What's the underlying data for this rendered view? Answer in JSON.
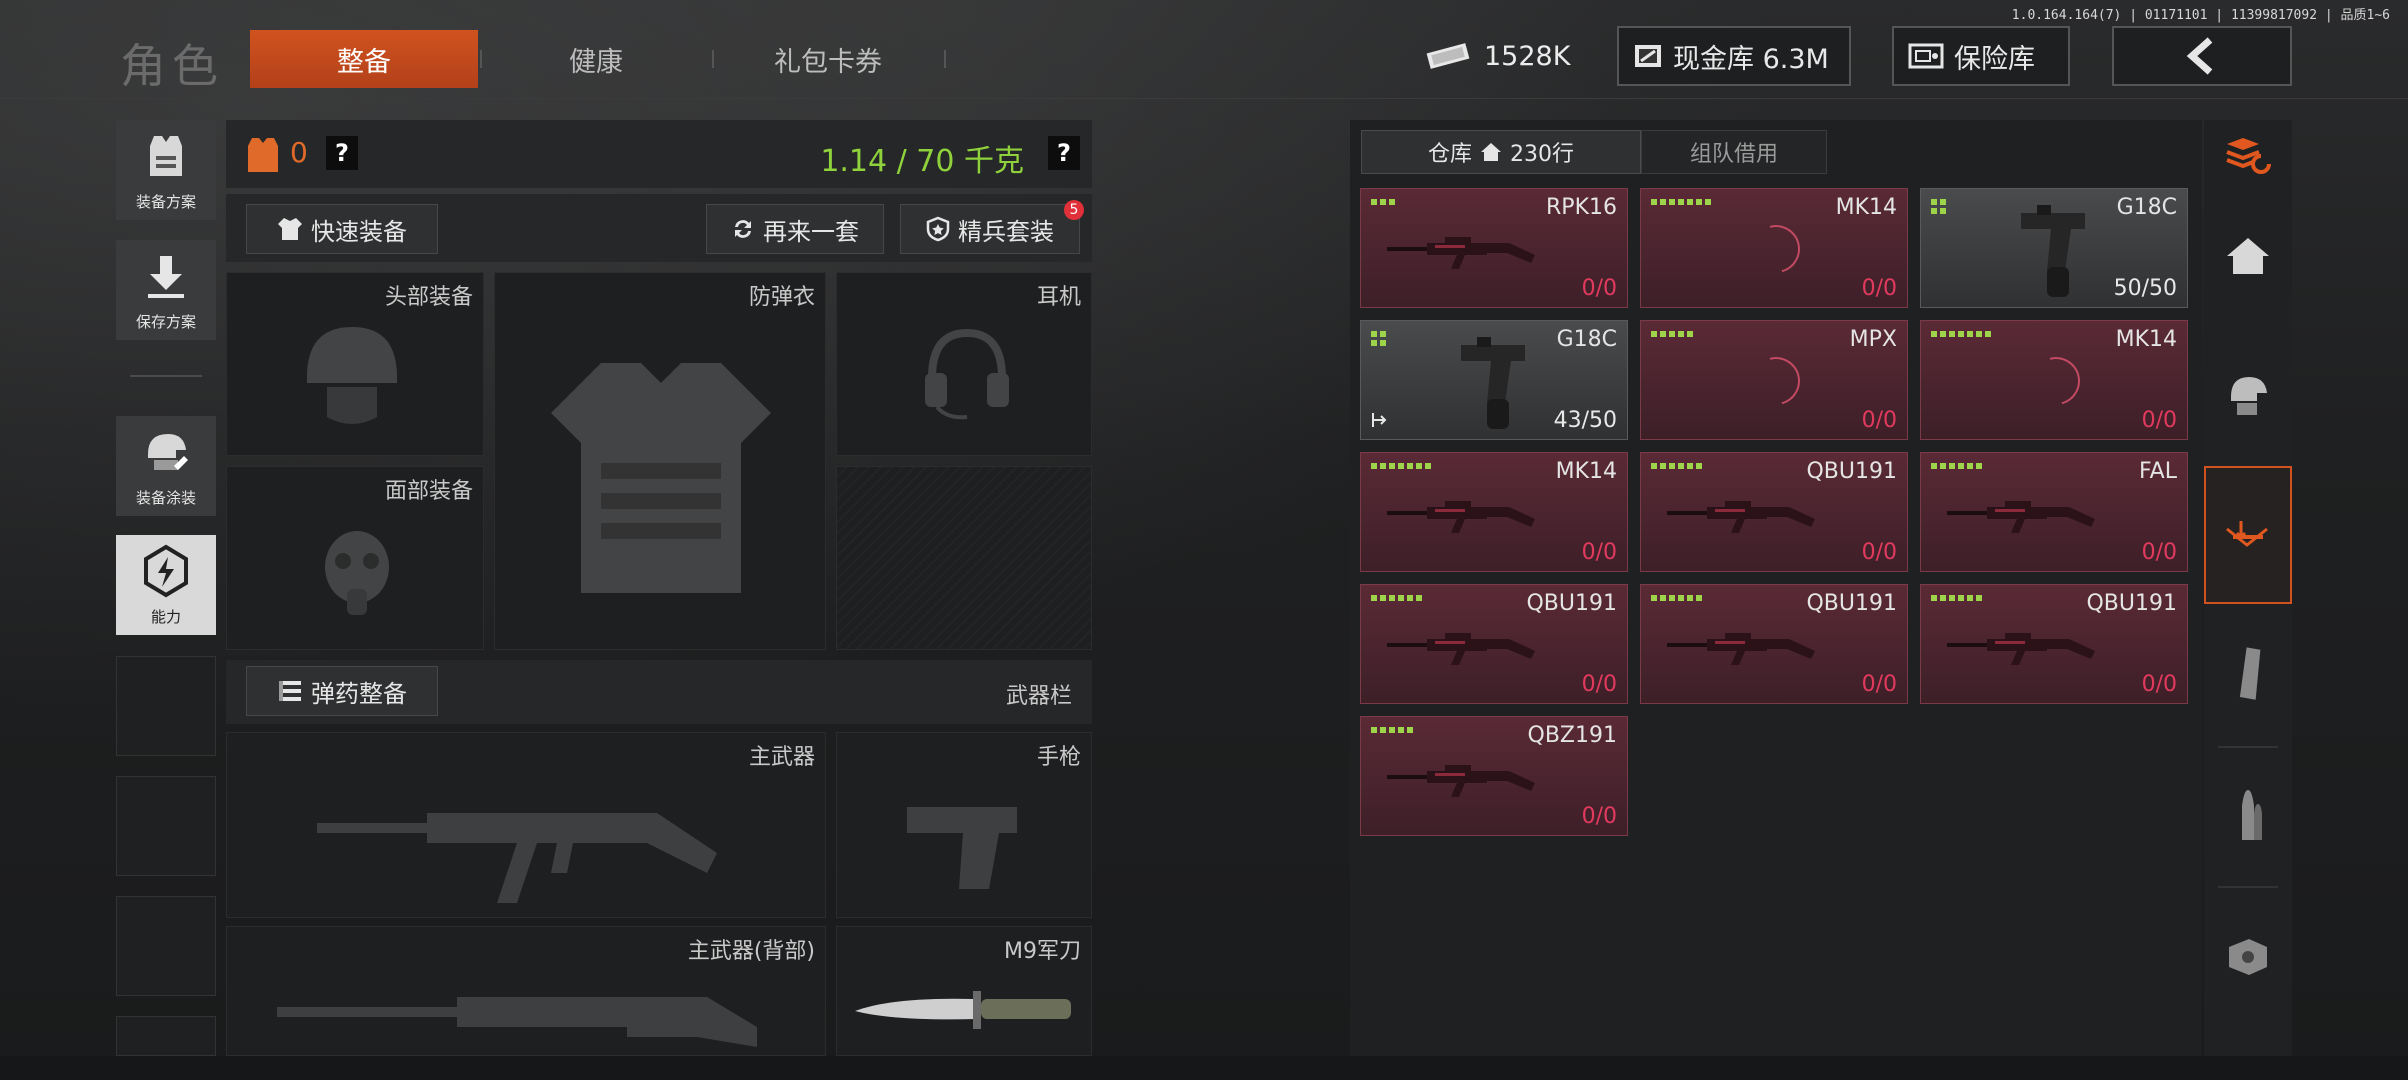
{
  "build_info": "1.0.164.164(7) | 01171101 | 11399817092 | 品质1~6",
  "header": {
    "title": "角色",
    "tabs": [
      "整备",
      "健康",
      "礼包卡券"
    ],
    "active_tab": "整备",
    "currency": "1528K",
    "cash_vault": "现金库 6.3M",
    "safe": "保险库"
  },
  "left_menu": {
    "plans": "装备方案",
    "save_plan": "保存方案",
    "skins": "装备涂装",
    "ability": "能力"
  },
  "loadout": {
    "armor_level": "0",
    "help": "?",
    "weight": "1.14 / 70 千克",
    "quick_equip": "快速装备",
    "again": "再来一套",
    "elite_set": "精兵套装",
    "elite_badge": "5",
    "slots": {
      "head": "头部装备",
      "vest": "防弹衣",
      "headset": "耳机",
      "face": "面部装备"
    },
    "ammo_btn": "弹药整备",
    "weapon_bar": "武器栏",
    "weapons": {
      "primary": "主武器",
      "pistol": "手枪",
      "primary_back": "主武器(背部)",
      "knife": "M9军刀"
    }
  },
  "storage": {
    "tab_storage": "仓库",
    "rows": "230行",
    "tab_team": "组队借用",
    "items": [
      {
        "name": "RPK16",
        "count": "0/0",
        "quality": 3,
        "style": "red",
        "icon": "rifle"
      },
      {
        "name": "MK14",
        "count": "0/0",
        "quality": 7,
        "style": "red",
        "icon": "loading"
      },
      {
        "name": "G18C",
        "count": "50/50",
        "quality": 4,
        "style": "gray",
        "icon": "pistol"
      },
      {
        "name": "G18C",
        "count": "43/50",
        "quality": 4,
        "style": "gray",
        "icon": "pistol"
      },
      {
        "name": "MPX",
        "count": "0/0",
        "quality": 5,
        "style": "red",
        "icon": "loading"
      },
      {
        "name": "MK14",
        "count": "0/0",
        "quality": 7,
        "style": "red",
        "icon": "loading"
      },
      {
        "name": "MK14",
        "count": "0/0",
        "quality": 7,
        "style": "red",
        "icon": "rifle"
      },
      {
        "name": "QBU191",
        "count": "0/0",
        "quality": 6,
        "style": "red",
        "icon": "rifle"
      },
      {
        "name": "FAL",
        "count": "0/0",
        "quality": 6,
        "style": "red",
        "icon": "rifle"
      },
      {
        "name": "QBU191",
        "count": "0/0",
        "quality": 6,
        "style": "red",
        "icon": "rifle"
      },
      {
        "name": "QBU191",
        "count": "0/0",
        "quality": 6,
        "style": "red",
        "icon": "rifle"
      },
      {
        "name": "QBU191",
        "count": "0/0",
        "quality": 6,
        "style": "red",
        "icon": "rifle"
      },
      {
        "name": "QBZ191",
        "count": "0/0",
        "quality": 5,
        "style": "red",
        "icon": "rifle"
      }
    ]
  },
  "colors": {
    "accent": "#c8501e",
    "weight_green": "#8fd23b",
    "empty_count": "#e23a5e",
    "quality_green": "#9ed44a"
  }
}
